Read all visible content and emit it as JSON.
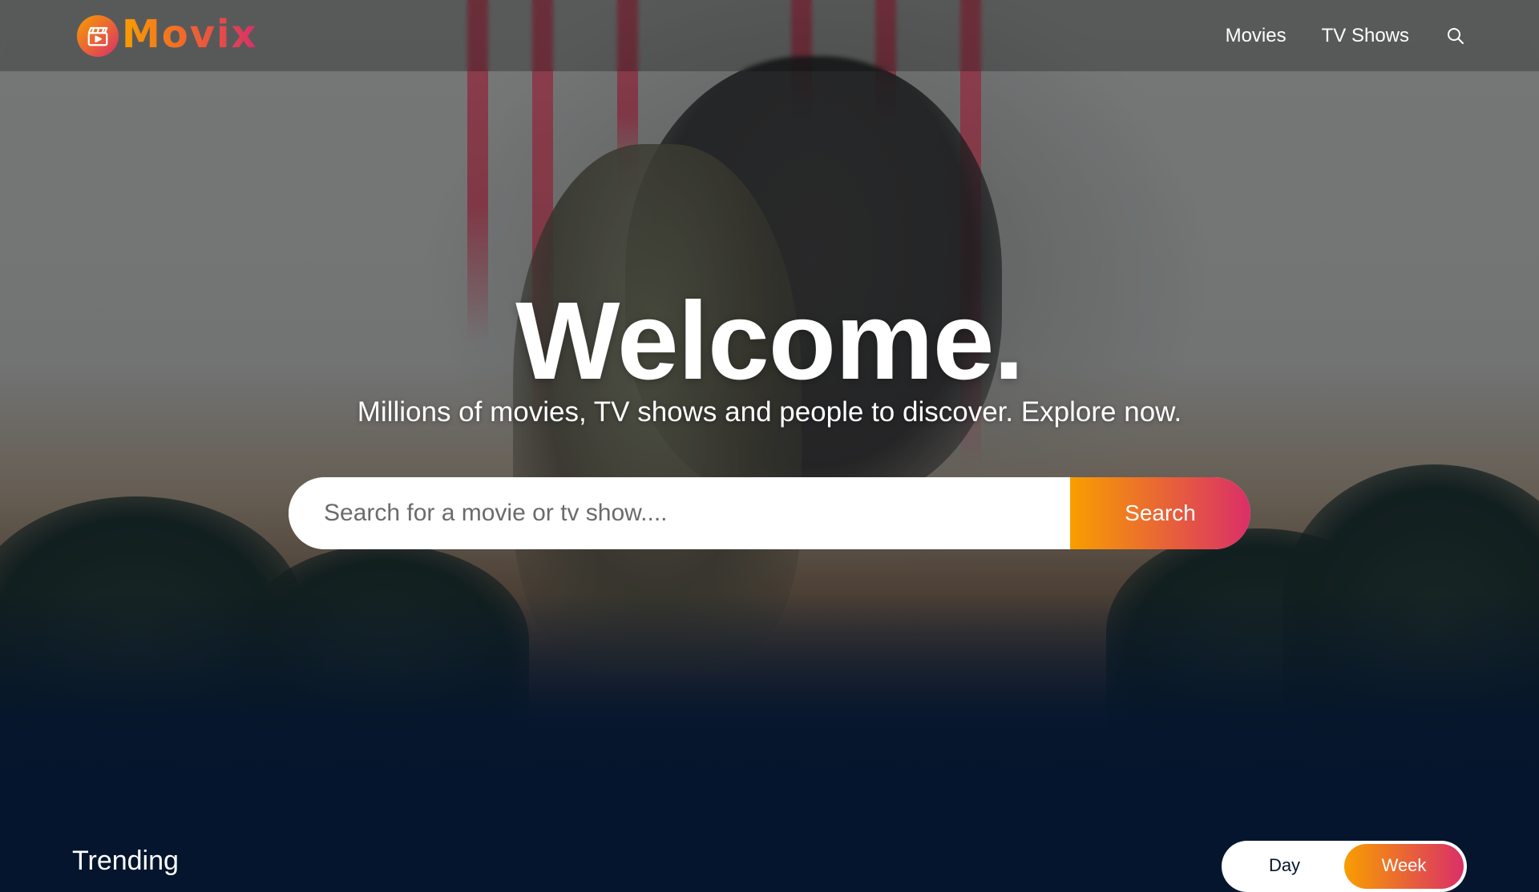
{
  "header": {
    "logo_text": "Movix",
    "nav": [
      {
        "label": "Movies"
      },
      {
        "label": "TV Shows"
      }
    ],
    "search_icon": "search-icon"
  },
  "hero": {
    "title": "Welcome.",
    "subtitle": "Millions of movies, TV shows and people to discover. Explore now.",
    "search": {
      "placeholder": "Search for a movie or tv show....",
      "value": "",
      "button_label": "Search"
    }
  },
  "trending": {
    "title": "Trending",
    "tabs": [
      {
        "label": "Day",
        "active": false
      },
      {
        "label": "Week",
        "active": true
      }
    ]
  },
  "colors": {
    "background": "#04152d",
    "gradient_start": "#f89e00",
    "gradient_end": "#da2f68"
  }
}
